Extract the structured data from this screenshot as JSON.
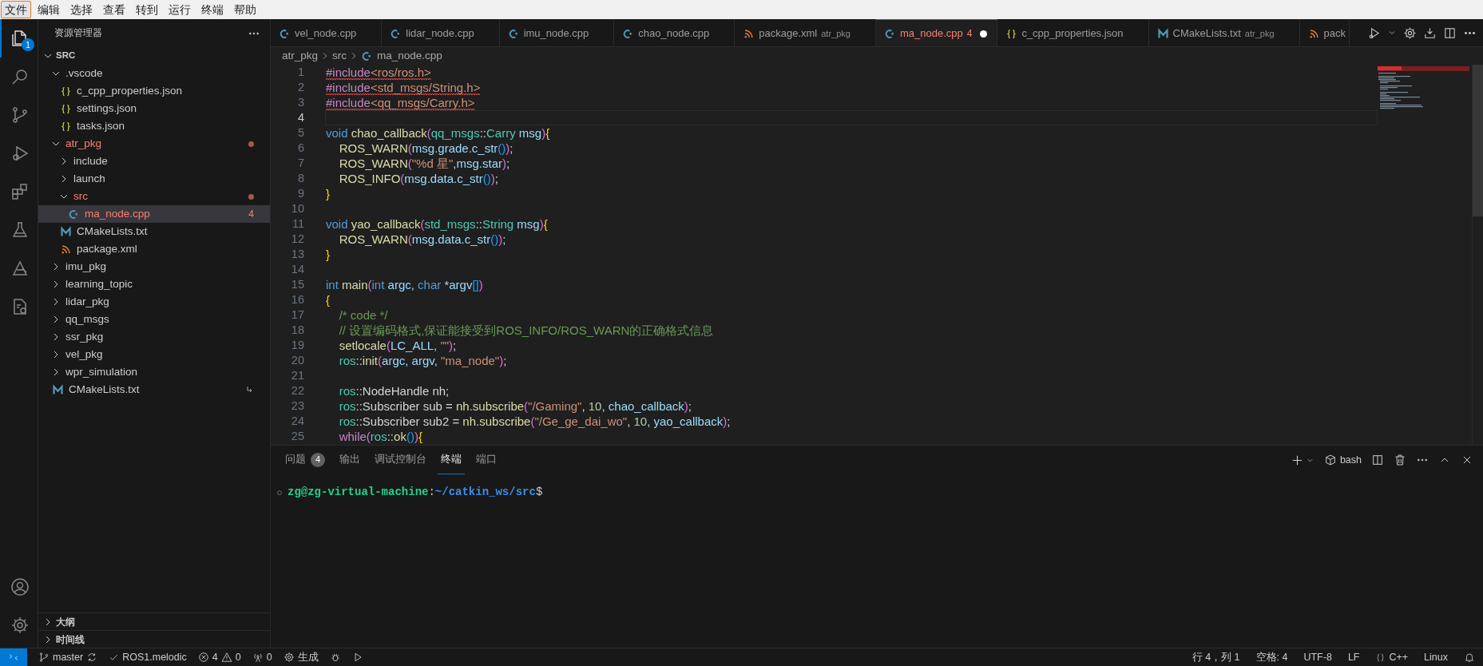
{
  "menu": [
    {
      "label": "文件",
      "selected": true
    },
    {
      "label": "编辑",
      "selected": false
    },
    {
      "label": "选择",
      "selected": false
    },
    {
      "label": "查看",
      "selected": false
    },
    {
      "label": "转到",
      "selected": false
    },
    {
      "label": "运行",
      "selected": false
    },
    {
      "label": "终端",
      "selected": false
    },
    {
      "label": "帮助",
      "selected": false
    }
  ],
  "activity_bar": [
    {
      "kind": "explorer",
      "selected": true,
      "badge": "1"
    },
    {
      "kind": "search",
      "selected": false
    },
    {
      "kind": "scm",
      "selected": false
    },
    {
      "kind": "debug",
      "selected": false
    },
    {
      "kind": "extensions",
      "selected": false
    },
    {
      "kind": "testing",
      "selected": false
    },
    {
      "kind": "ros",
      "selected": false
    },
    {
      "kind": "cmake",
      "selected": false
    }
  ],
  "activity_bar_bottom": [
    {
      "kind": "account",
      "selected": false
    },
    {
      "kind": "settings",
      "selected": false
    }
  ],
  "explorer": {
    "title": "资源管理器",
    "root": {
      "label": "SRC",
      "expanded": true
    },
    "items": [
      {
        "label": ".vscode",
        "kind": "folder",
        "expanded": true,
        "selected": false,
        "error": false,
        "children": [
          {
            "label": "c_cpp_properties.json",
            "kind": "json",
            "selected": false,
            "error": false
          },
          {
            "label": "settings.json",
            "kind": "json",
            "selected": false,
            "error": false
          },
          {
            "label": "tasks.json",
            "kind": "json",
            "selected": false,
            "error": false
          }
        ]
      },
      {
        "label": "atr_pkg",
        "kind": "folder",
        "expanded": true,
        "selected": false,
        "error": true,
        "children": [
          {
            "label": "include",
            "kind": "folder",
            "expanded": false,
            "selected": false,
            "error": false
          },
          {
            "label": "launch",
            "kind": "folder",
            "expanded": false,
            "selected": false,
            "error": false
          },
          {
            "label": "src",
            "kind": "folder",
            "expanded": true,
            "selected": false,
            "error": true,
            "children": [
              {
                "label": "ma_node.cpp",
                "kind": "cpp",
                "selected": true,
                "error": true,
                "badge": "4"
              }
            ]
          },
          {
            "label": "CMakeLists.txt",
            "kind": "cmake",
            "selected": false,
            "error": false
          },
          {
            "label": "package.xml",
            "kind": "xml",
            "selected": false,
            "error": false
          }
        ]
      },
      {
        "label": "imu_pkg",
        "kind": "folder",
        "expanded": false,
        "selected": false,
        "error": false
      },
      {
        "label": "learning_topic",
        "kind": "folder",
        "expanded": false,
        "selected": false,
        "error": false
      },
      {
        "label": "lidar_pkg",
        "kind": "folder",
        "expanded": false,
        "selected": false,
        "error": false
      },
      {
        "label": "qq_msgs",
        "kind": "folder",
        "expanded": false,
        "selected": false,
        "error": false
      },
      {
        "label": "ssr_pkg",
        "kind": "folder",
        "expanded": false,
        "selected": false,
        "error": false
      },
      {
        "label": "vel_pkg",
        "kind": "folder",
        "expanded": false,
        "selected": false,
        "error": false
      },
      {
        "label": "wpr_simulation",
        "kind": "folder",
        "expanded": false,
        "selected": false,
        "error": false
      },
      {
        "label": "CMakeLists.txt",
        "kind": "cmake",
        "selected": false,
        "error": false,
        "symlink": true
      }
    ]
  },
  "sidebar_sections": [
    {
      "label": "大纲",
      "expanded": false
    },
    {
      "label": "时间线",
      "expanded": false
    }
  ],
  "tabs": [
    {
      "label": "vel_node.cpp",
      "kind": "cpp",
      "selected": false,
      "error": false,
      "dirty": false
    },
    {
      "label": "lidar_node.cpp",
      "kind": "cpp",
      "selected": false,
      "error": false,
      "dirty": false
    },
    {
      "label": "imu_node.cpp",
      "kind": "cpp",
      "selected": false,
      "error": false,
      "dirty": false
    },
    {
      "label": "chao_node.cpp",
      "kind": "cpp",
      "selected": false,
      "error": false,
      "dirty": false
    },
    {
      "label": "package.xml",
      "description": "atr_pkg",
      "kind": "xml",
      "selected": false,
      "error": false,
      "dirty": false
    },
    {
      "label": "ma_node.cpp",
      "badge": "4",
      "kind": "cpp",
      "selected": true,
      "error": true,
      "dirty": true
    },
    {
      "label": "c_cpp_properties.json",
      "kind": "json",
      "selected": false,
      "error": false,
      "dirty": false
    },
    {
      "label": "CMakeLists.txt",
      "description": "atr_pkg",
      "kind": "cmake",
      "selected": false,
      "error": false,
      "dirty": false
    },
    {
      "label": "pack",
      "kind": "xml",
      "selected": false,
      "error": false
    }
  ],
  "breadcrumb": [
    "atr_pkg",
    "src",
    "ma_node.cpp"
  ],
  "code": [
    {
      "number": "1",
      "current": false,
      "error": true,
      "tokens": [
        {
          "text": "#include",
          "kind": "dir"
        },
        {
          "text": "<ros/ros.h>",
          "kind": "str"
        }
      ]
    },
    {
      "number": "2",
      "current": false,
      "error": true,
      "tokens": [
        {
          "text": "#include",
          "kind": "dir"
        },
        {
          "text": "<std_msgs/String.h>",
          "kind": "str"
        }
      ]
    },
    {
      "number": "3",
      "current": false,
      "error": true,
      "tokens": [
        {
          "text": "#include",
          "kind": "dir"
        },
        {
          "text": "<qq_msgs/Carry.h>",
          "kind": "str"
        }
      ]
    },
    {
      "number": "4",
      "current": true
    },
    {
      "number": "5",
      "current": false,
      "error": false,
      "tokens": [
        {
          "text": "void",
          "kind": "kw"
        },
        {
          "text": " chao_callback",
          "kind": "fn"
        },
        {
          "text": "(",
          "kind": "p1"
        },
        {
          "text": "qq_msgs",
          "kind": "type"
        },
        {
          "text": "::",
          "kind": "plain"
        },
        {
          "text": "Carry",
          "kind": "type"
        },
        {
          "text": " msg",
          "kind": "var"
        },
        {
          "text": ")",
          "kind": "p1"
        },
        {
          "text": "{",
          "kind": "br"
        }
      ]
    },
    {
      "number": "6",
      "current": false,
      "error": false,
      "tokens": [
        {
          "text": "    ROS_WARN",
          "kind": "fn"
        },
        {
          "text": "(",
          "kind": "p1"
        },
        {
          "text": "msg.grade.c_str",
          "kind": "var"
        },
        {
          "text": "()",
          "kind": "p2"
        },
        {
          "text": ")",
          "kind": "p1"
        },
        {
          "text": ";",
          "kind": "plain"
        }
      ]
    },
    {
      "number": "7",
      "current": false,
      "error": false,
      "tokens": [
        {
          "text": "    ROS_WARN",
          "kind": "fn"
        },
        {
          "text": "(",
          "kind": "p1"
        },
        {
          "text": "\"%d 星\"",
          "kind": "str"
        },
        {
          "text": ",msg.star",
          "kind": "var"
        },
        {
          "text": ")",
          "kind": "p1"
        },
        {
          "text": ";",
          "kind": "plain"
        }
      ]
    },
    {
      "number": "8",
      "current": false,
      "error": false,
      "tokens": [
        {
          "text": "    ROS_INFO",
          "kind": "fn"
        },
        {
          "text": "(",
          "kind": "p1"
        },
        {
          "text": "msg.data.c_str",
          "kind": "var"
        },
        {
          "text": "()",
          "kind": "p2"
        },
        {
          "text": ")",
          "kind": "p1"
        },
        {
          "text": ";",
          "kind": "plain"
        }
      ]
    },
    {
      "number": "9",
      "current": false,
      "error": false,
      "tokens": [
        {
          "text": "}",
          "kind": "br"
        }
      ]
    },
    {
      "number": "10",
      "current": false
    },
    {
      "number": "11",
      "current": false,
      "error": false,
      "tokens": [
        {
          "text": "void",
          "kind": "kw"
        },
        {
          "text": " yao_callback",
          "kind": "fn"
        },
        {
          "text": "(",
          "kind": "p1"
        },
        {
          "text": "std_msgs",
          "kind": "type"
        },
        {
          "text": "::",
          "kind": "plain"
        },
        {
          "text": "String",
          "kind": "type"
        },
        {
          "text": " msg",
          "kind": "var"
        },
        {
          "text": ")",
          "kind": "p1"
        },
        {
          "text": "{",
          "kind": "br"
        }
      ]
    },
    {
      "number": "12",
      "current": false,
      "error": false,
      "tokens": [
        {
          "text": "    ROS_WARN",
          "kind": "fn"
        },
        {
          "text": "(",
          "kind": "p1"
        },
        {
          "text": "msg.data.c_str",
          "kind": "var"
        },
        {
          "text": "()",
          "kind": "p2"
        },
        {
          "text": ")",
          "kind": "p1"
        },
        {
          "text": ";",
          "kind": "plain"
        }
      ]
    },
    {
      "number": "13",
      "current": false,
      "error": false,
      "tokens": [
        {
          "text": "}",
          "kind": "br"
        }
      ]
    },
    {
      "number": "14",
      "current": false
    },
    {
      "number": "15",
      "current": false,
      "error": false,
      "tokens": [
        {
          "text": "int",
          "kind": "kw"
        },
        {
          "text": " main",
          "kind": "fn"
        },
        {
          "text": "(",
          "kind": "p1"
        },
        {
          "text": "int",
          "kind": "kw"
        },
        {
          "text": " argc, ",
          "kind": "var"
        },
        {
          "text": "char",
          "kind": "kw"
        },
        {
          "text": " *argv",
          "kind": "var"
        },
        {
          "text": "[]",
          "kind": "p2"
        },
        {
          "text": ")",
          "kind": "p1"
        }
      ]
    },
    {
      "number": "16",
      "current": false,
      "error": false,
      "tokens": [
        {
          "text": "{",
          "kind": "br"
        }
      ]
    },
    {
      "number": "17",
      "current": false,
      "error": false,
      "tokens": [
        {
          "text": "    /* code */",
          "kind": "com"
        }
      ]
    },
    {
      "number": "18",
      "current": false,
      "error": false,
      "tokens": [
        {
          "text": "    // 设置编码格式,保证能接受到ROS_INFO/ROS_WARN的正确格式信息",
          "kind": "com"
        }
      ]
    },
    {
      "number": "19",
      "current": false,
      "error": false,
      "tokens": [
        {
          "text": "    setlocale",
          "kind": "fn"
        },
        {
          "text": "(",
          "kind": "p1"
        },
        {
          "text": "LC_ALL, ",
          "kind": "var"
        },
        {
          "text": "\"\"",
          "kind": "str"
        },
        {
          "text": ")",
          "kind": "p1"
        },
        {
          "text": ";",
          "kind": "plain"
        }
      ]
    },
    {
      "number": "20",
      "current": false,
      "error": false,
      "tokens": [
        {
          "text": "    ros",
          "kind": "type"
        },
        {
          "text": "::",
          "kind": "plain"
        },
        {
          "text": "init",
          "kind": "fn"
        },
        {
          "text": "(",
          "kind": "p1"
        },
        {
          "text": "argc, argv, ",
          "kind": "var"
        },
        {
          "text": "\"ma_node\"",
          "kind": "str"
        },
        {
          "text": ")",
          "kind": "p1"
        },
        {
          "text": ";",
          "kind": "plain"
        }
      ]
    },
    {
      "number": "21",
      "current": false
    },
    {
      "number": "22",
      "current": false,
      "error": false,
      "tokens": [
        {
          "text": "    ros",
          "kind": "type"
        },
        {
          "text": "::",
          "kind": "plain"
        },
        {
          "text": "NodeHandle nh;",
          "kind": "plain"
        }
      ]
    },
    {
      "number": "23",
      "current": false,
      "error": false,
      "tokens": [
        {
          "text": "    ros",
          "kind": "type"
        },
        {
          "text": "::",
          "kind": "plain"
        },
        {
          "text": "Subscriber sub = ",
          "kind": "plain"
        },
        {
          "text": "nh.subscribe",
          "kind": "fn"
        },
        {
          "text": "(",
          "kind": "p1"
        },
        {
          "text": "\"/Gaming\"",
          "kind": "str"
        },
        {
          "text": ", ",
          "kind": "plain"
        },
        {
          "text": "10",
          "kind": "num"
        },
        {
          "text": ", chao_callback",
          "kind": "var"
        },
        {
          "text": ")",
          "kind": "p1"
        },
        {
          "text": ";",
          "kind": "plain"
        }
      ]
    },
    {
      "number": "24",
      "current": false,
      "error": false,
      "tokens": [
        {
          "text": "    ros",
          "kind": "type"
        },
        {
          "text": "::",
          "kind": "plain"
        },
        {
          "text": "Subscriber sub2 = ",
          "kind": "plain"
        },
        {
          "text": "nh.subscribe",
          "kind": "fn"
        },
        {
          "text": "(",
          "kind": "p1"
        },
        {
          "text": "\"/Ge_ge_dai_wo\"",
          "kind": "str"
        },
        {
          "text": ", ",
          "kind": "plain"
        },
        {
          "text": "10",
          "kind": "num"
        },
        {
          "text": ", yao_callback",
          "kind": "var"
        },
        {
          "text": ")",
          "kind": "p1"
        },
        {
          "text": ";",
          "kind": "plain"
        }
      ]
    },
    {
      "number": "25",
      "current": false,
      "error": false,
      "tokens": [
        {
          "text": "    while",
          "kind": "ctl"
        },
        {
          "text": "(",
          "kind": "p1"
        },
        {
          "text": "ros",
          "kind": "type"
        },
        {
          "text": "::",
          "kind": "plain"
        },
        {
          "text": "ok",
          "kind": "fn"
        },
        {
          "text": "()",
          "kind": "p2"
        },
        {
          "text": ")",
          "kind": "p1"
        },
        {
          "text": "{",
          "kind": "br"
        }
      ]
    }
  ],
  "panel": {
    "tabs": [
      {
        "label": "问题",
        "badge": "4",
        "selected": false
      },
      {
        "label": "输出",
        "selected": false
      },
      {
        "label": "调试控制台",
        "selected": false
      },
      {
        "label": "终端",
        "selected": true
      },
      {
        "label": "端口",
        "selected": false
      }
    ],
    "shell": "bash",
    "terminal": {
      "user_host": "zg@zg-virtual-machine",
      "separator": ":",
      "path": "~/catkin_ws/src",
      "prompt": "$"
    }
  },
  "status_bar": {
    "left": [
      {
        "kind": "remote"
      },
      {
        "kind": "branch",
        "text": "master"
      },
      {
        "kind": "ros",
        "text": "ROS1.melodic"
      },
      {
        "kind": "problems",
        "errors": "4",
        "warnings": "0"
      },
      {
        "kind": "ports",
        "text": "0"
      },
      {
        "kind": "build",
        "text": "生成"
      },
      {
        "kind": "debug"
      },
      {
        "kind": "run"
      }
    ],
    "right": [
      {
        "kind": "cursor",
        "text": "行 4，列 1"
      },
      {
        "kind": "indent",
        "text": "空格: 4"
      },
      {
        "kind": "encoding",
        "text": "UTF-8"
      },
      {
        "kind": "eol",
        "text": "LF"
      },
      {
        "kind": "language",
        "text": "C++"
      },
      {
        "kind": "os",
        "text": "Linux"
      },
      {
        "kind": "notifications"
      }
    ]
  }
}
